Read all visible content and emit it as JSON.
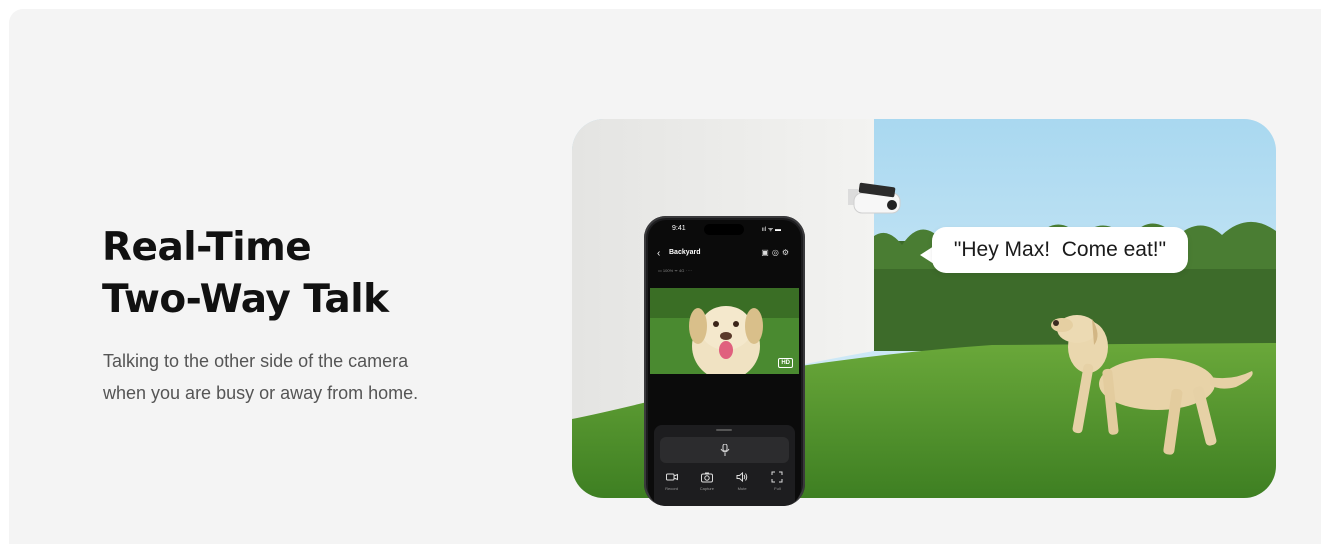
{
  "headline": {
    "line1": "Real-Time",
    "line2": "Two-Way Talk"
  },
  "description": {
    "line1": "Talking to the other side of the camera",
    "line2": "when you are busy or away from home."
  },
  "speech_bubble": "\"Hey Max!  Come eat!\"",
  "phone": {
    "time": "9:41",
    "status_icons": "ııl ᯤ ▬",
    "screen_title": "Backyard",
    "info_line": "▭ 100%  ᯤ 4G  ·  ···",
    "hd_badge": "HD",
    "controls": [
      {
        "label": "Record",
        "icon": "video-camera-icon"
      },
      {
        "label": "Capture",
        "icon": "camera-icon"
      },
      {
        "label": "Mute",
        "icon": "speaker-icon"
      },
      {
        "label": "Full",
        "icon": "fullscreen-icon"
      }
    ]
  },
  "colors": {
    "card_background": "#f4f4f4",
    "headline": "#111111",
    "description": "#555555",
    "grass": "#4f8f2e",
    "sky": "#bfe3f5"
  }
}
